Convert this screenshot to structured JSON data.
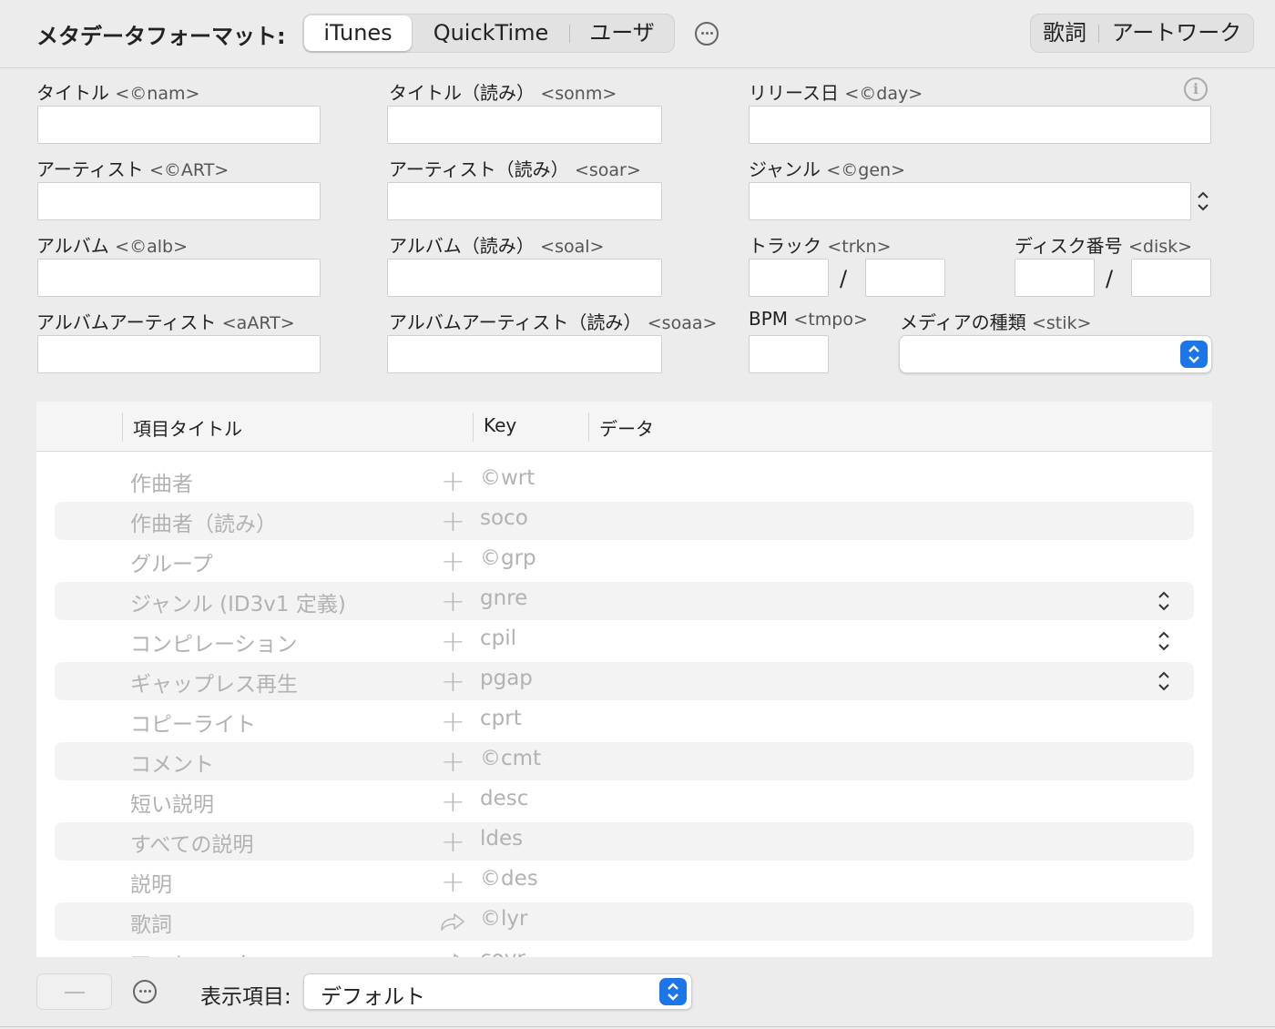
{
  "header": {
    "format_label": "メタデータフォーマット:",
    "tabs": [
      "iTunes",
      "QuickTime",
      "ユーザ"
    ],
    "selected_tab": "iTunes",
    "right_tabs": [
      "歌詞",
      "アートワーク"
    ]
  },
  "fields": {
    "title": {
      "label": "タイトル",
      "tag": "<©nam>"
    },
    "title_sort": {
      "label": "タイトル（読み）",
      "tag": "<sonm>"
    },
    "release": {
      "label": "リリース日",
      "tag": "<©day>"
    },
    "artist": {
      "label": "アーティスト",
      "tag": "<©ART>"
    },
    "artist_sort": {
      "label": "アーティスト（読み）",
      "tag": "<soar>"
    },
    "genre": {
      "label": "ジャンル",
      "tag": "<©gen>"
    },
    "album": {
      "label": "アルバム",
      "tag": "<©alb>"
    },
    "album_sort": {
      "label": "アルバム（読み）",
      "tag": "<soal>"
    },
    "track": {
      "label": "トラック",
      "tag": "<trkn>"
    },
    "disk": {
      "label": "ディスク番号",
      "tag": "<disk>"
    },
    "album_artist": {
      "label": "アルバムアーティスト",
      "tag": "<aART>"
    },
    "album_artist_sort": {
      "label": "アルバムアーティスト（読み）",
      "tag": "<soaa>"
    },
    "bpm": {
      "label": "BPM",
      "tag": "<tmpo>"
    },
    "media_kind": {
      "label": "メディアの種類",
      "tag": "<stik>"
    },
    "slash": "/"
  },
  "table": {
    "columns": [
      "項目タイトル",
      "Key",
      "データ"
    ],
    "rows": [
      {
        "title": "作曲者",
        "key": "©wrt",
        "action": "plus",
        "stepper": false
      },
      {
        "title": "作曲者（読み）",
        "key": "soco",
        "action": "plus",
        "stepper": false
      },
      {
        "title": "グループ",
        "key": "©grp",
        "action": "plus",
        "stepper": false
      },
      {
        "title": "ジャンル (ID3v1 定義)",
        "key": "gnre",
        "action": "plus",
        "stepper": true
      },
      {
        "title": "コンピレーション",
        "key": "cpil",
        "action": "plus",
        "stepper": true
      },
      {
        "title": "ギャップレス再生",
        "key": "pgap",
        "action": "plus",
        "stepper": true
      },
      {
        "title": "コピーライト",
        "key": "cprt",
        "action": "plus",
        "stepper": false
      },
      {
        "title": "コメント",
        "key": "©cmt",
        "action": "plus",
        "stepper": false
      },
      {
        "title": "短い説明",
        "key": "desc",
        "action": "plus",
        "stepper": false
      },
      {
        "title": "すべての説明",
        "key": "ldes",
        "action": "plus",
        "stepper": false
      },
      {
        "title": "説明",
        "key": "©des",
        "action": "plus",
        "stepper": false
      },
      {
        "title": "歌詞",
        "key": "©lyr",
        "action": "share",
        "stepper": false
      },
      {
        "title": "アートワーク",
        "key": "covr",
        "action": "share",
        "stepper": false
      }
    ]
  },
  "footer": {
    "show_label": "表示項目:",
    "show_value": "デフォルト"
  }
}
